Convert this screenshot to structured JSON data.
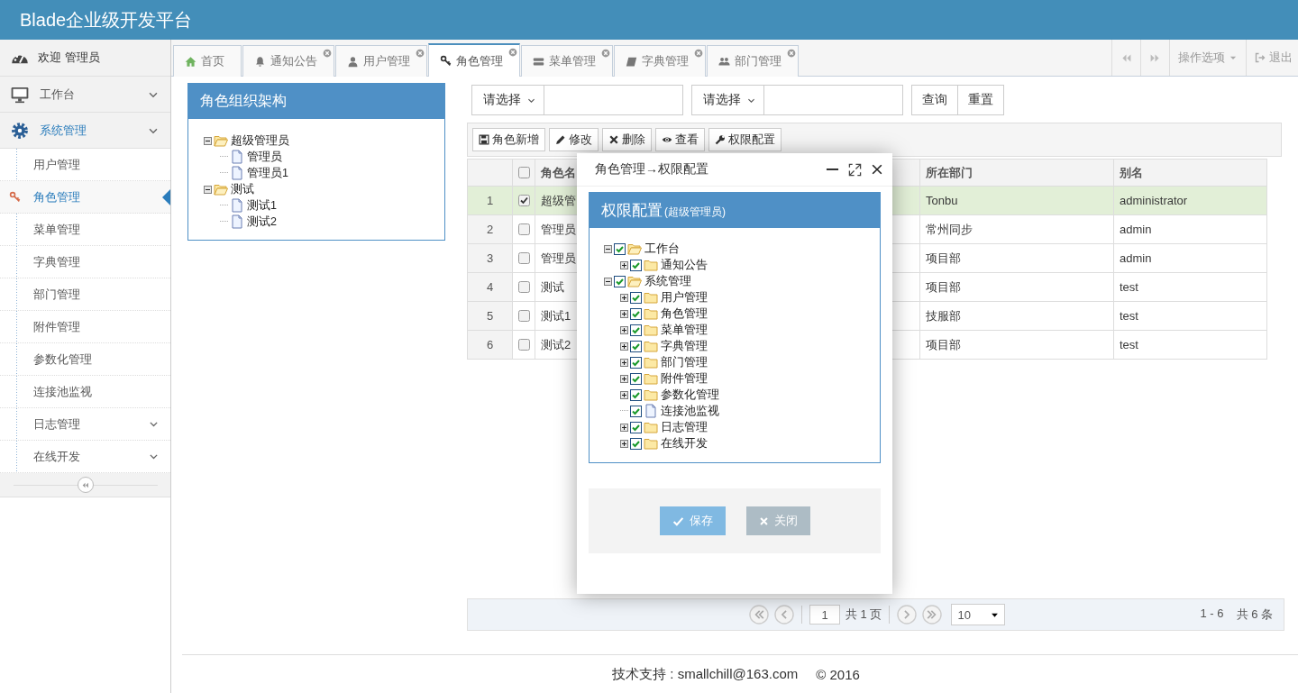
{
  "header": {
    "title": "Blade企业级开发平台"
  },
  "sidebar": {
    "user": "欢迎 管理员",
    "items": [
      {
        "label": "工作台",
        "kind": "group",
        "selected": false
      },
      {
        "label": "系统管理",
        "kind": "group",
        "selected": true,
        "children": [
          {
            "label": "用户管理",
            "kind": "link",
            "selected": false
          },
          {
            "label": "角色管理",
            "kind": "link",
            "selected": true
          },
          {
            "label": "菜单管理",
            "kind": "link",
            "selected": false
          },
          {
            "label": "字典管理",
            "kind": "link",
            "selected": false
          },
          {
            "label": "部门管理",
            "kind": "link",
            "selected": false
          },
          {
            "label": "附件管理",
            "kind": "link",
            "selected": false
          },
          {
            "label": "参数化管理",
            "kind": "link",
            "selected": false
          },
          {
            "label": "连接池监视",
            "kind": "link",
            "selected": false
          },
          {
            "label": "日志管理",
            "kind": "group",
            "selected": false
          },
          {
            "label": "在线开发",
            "kind": "group",
            "selected": false
          }
        ]
      }
    ]
  },
  "tabs": [
    {
      "label": "首页",
      "selected": false,
      "closable": false
    },
    {
      "label": "通知公告",
      "selected": false,
      "closable": true
    },
    {
      "label": "用户管理",
      "selected": false,
      "closable": true
    },
    {
      "label": "角色管理",
      "selected": true,
      "closable": true
    },
    {
      "label": "菜单管理",
      "selected": false,
      "closable": true
    },
    {
      "label": "字典管理",
      "selected": false,
      "closable": true
    },
    {
      "label": "部门管理",
      "selected": false,
      "closable": true
    }
  ],
  "tab_tools": {
    "options": "操作选项",
    "logout": "退出"
  },
  "role_tree": {
    "title": "角色组织架构",
    "nodes": [
      {
        "label": "超级管理员",
        "kind": "folder",
        "expanded": true,
        "children": [
          {
            "label": "管理员",
            "kind": "file"
          },
          {
            "label": "管理员1",
            "kind": "file"
          }
        ]
      },
      {
        "label": "测试",
        "kind": "folder",
        "expanded": true,
        "children": [
          {
            "label": "测试1",
            "kind": "file"
          },
          {
            "label": "测试2",
            "kind": "file"
          }
        ]
      }
    ]
  },
  "filters": [
    {
      "select": "请选择"
    },
    {
      "select": "请选择"
    }
  ],
  "search_buttons": [
    "查询",
    "重置"
  ],
  "toolbar": [
    "角色新增",
    "修改",
    "删除",
    "查看",
    "权限配置"
  ],
  "table": {
    "all_checked": false,
    "columns": [
      "角色名",
      "所在部门",
      "别名"
    ],
    "rows": [
      {
        "index": "1",
        "checked": true,
        "selected": true,
        "name": "超级管",
        "dept": "Tonbu",
        "alias": "administrator"
      },
      {
        "index": "2",
        "checked": false,
        "selected": false,
        "name": "管理员",
        "dept": "常州同步",
        "alias": "admin"
      },
      {
        "index": "3",
        "checked": false,
        "selected": false,
        "name": "管理员",
        "dept": "项目部",
        "alias": "admin"
      },
      {
        "index": "4",
        "checked": false,
        "selected": false,
        "name": "测试",
        "dept": "项目部",
        "alias": "test"
      },
      {
        "index": "5",
        "checked": false,
        "selected": false,
        "name": "测试1",
        "dept": "技服部",
        "alias": "test"
      },
      {
        "index": "6",
        "checked": false,
        "selected": false,
        "name": "测试2",
        "dept": "项目部",
        "alias": "test"
      }
    ]
  },
  "pager": {
    "page": "1",
    "pages": "共 1 页",
    "page_size": "10",
    "range": "1 - 6",
    "total": "共 6 条"
  },
  "dialog": {
    "title": "角色管理→权限配置",
    "panel_title": "权限配置",
    "panel_subtitle": "(超级管理员)",
    "buttons": [
      "保存",
      "关闭"
    ],
    "tree": [
      {
        "label": "工作台",
        "kind": "folder",
        "expanded": true,
        "checked": true,
        "children": [
          {
            "label": "通知公告",
            "kind": "folder",
            "expanded": false,
            "checked": true
          }
        ]
      },
      {
        "label": "系统管理",
        "kind": "folder",
        "expanded": true,
        "checked": true,
        "children": [
          {
            "label": "用户管理",
            "kind": "folder",
            "expanded": false,
            "checked": true
          },
          {
            "label": "角色管理",
            "kind": "folder",
            "expanded": false,
            "checked": true
          },
          {
            "label": "菜单管理",
            "kind": "folder",
            "expanded": false,
            "checked": true
          },
          {
            "label": "字典管理",
            "kind": "folder",
            "expanded": false,
            "checked": true
          },
          {
            "label": "部门管理",
            "kind": "folder",
            "expanded": false,
            "checked": true
          },
          {
            "label": "附件管理",
            "kind": "folder",
            "expanded": false,
            "checked": true
          },
          {
            "label": "参数化管理",
            "kind": "folder",
            "expanded": false,
            "checked": true
          },
          {
            "label": "连接池监视",
            "kind": "file",
            "checked": true
          },
          {
            "label": "日志管理",
            "kind": "folder",
            "expanded": false,
            "checked": true
          },
          {
            "label": "在线开发",
            "kind": "folder",
            "expanded": false,
            "checked": true
          }
        ]
      }
    ]
  },
  "footer": {
    "support": "技术支持 : smallchill@163.com",
    "copyright": "© 2016"
  }
}
